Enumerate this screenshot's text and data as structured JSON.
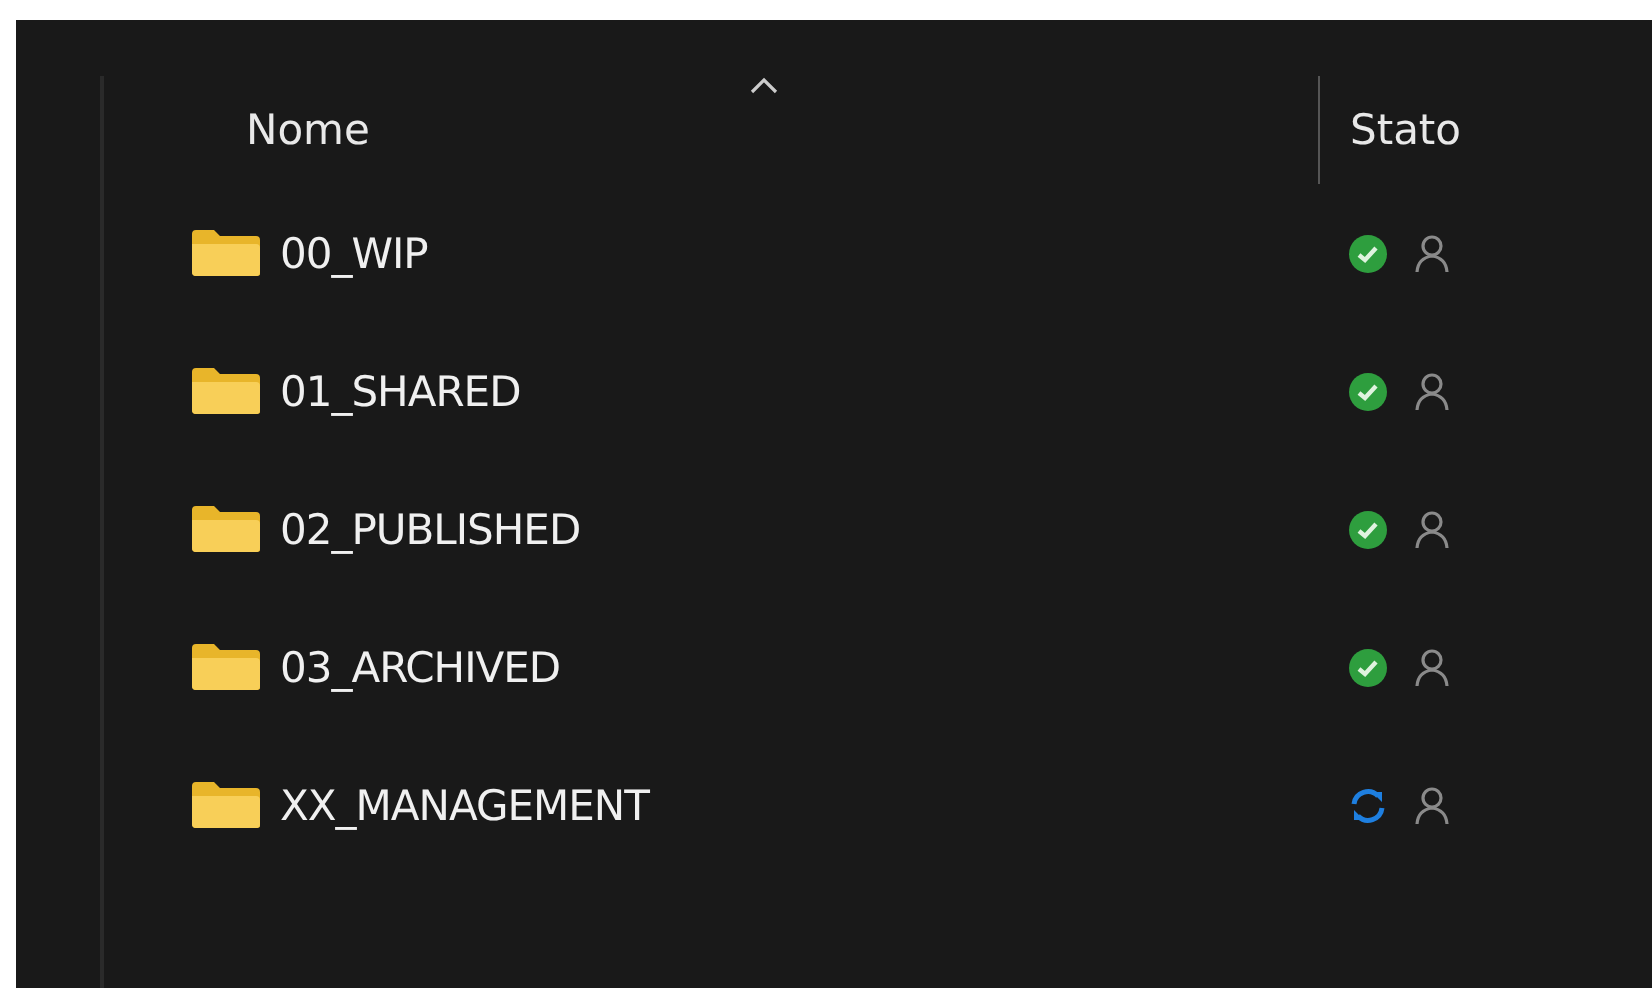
{
  "columns": [
    {
      "label": "Nome",
      "sorted": true
    },
    {
      "label": "Stato",
      "sorted": false
    }
  ],
  "rows": [
    {
      "name": "00_WIP",
      "kind": "synced"
    },
    {
      "name": "01_SHARED",
      "kind": "synced"
    },
    {
      "name": "02_PUBLISHED",
      "kind": "synced"
    },
    {
      "name": "03_ARCHIVED",
      "kind": "synced"
    },
    {
      "name": "XX_MANAGEMENT",
      "kind": "syncing"
    }
  ]
}
